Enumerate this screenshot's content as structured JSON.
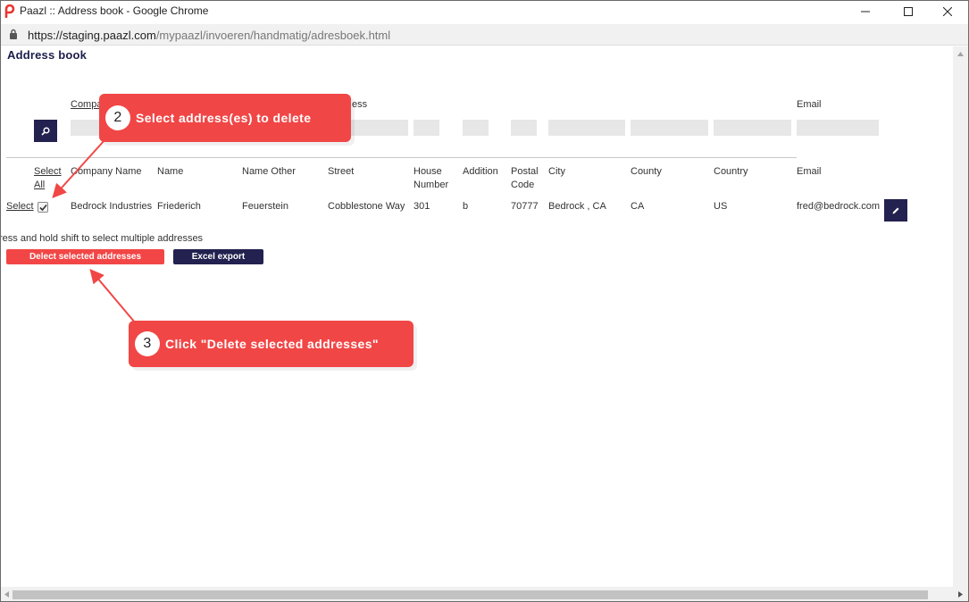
{
  "window": {
    "title": "Paazl :: Address book - Google Chrome",
    "icons": {
      "minimize": "minimize-icon",
      "maximize": "maximize-icon",
      "close": "close-icon",
      "app": "paazl-logo-icon"
    }
  },
  "addressbar": {
    "url_host": "https://staging.paazl.com",
    "url_path": "/mypaazl/invoeren/handmatig/adresboek.html",
    "icon": "lock-icon"
  },
  "page": {
    "title": "Address book"
  },
  "filter": {
    "headers": {
      "company": "Compa",
      "address": "ess",
      "email": "Email"
    },
    "search_icon": "search-icon"
  },
  "table": {
    "headers": {
      "select_all": "Select All",
      "company_name": "Company Name",
      "name": "Name",
      "name_other": "Name Other",
      "street": "Street",
      "house_number": "House Number",
      "addition": "Addition",
      "postal_code": "Postal Code",
      "city": "City",
      "county": "County",
      "country": "Country",
      "email": "Email"
    },
    "rows": [
      {
        "select": "Select",
        "checked": true,
        "company_name": "Bedrock Industries",
        "name": "Friederich",
        "name_other": "Feuerstein",
        "street": "Cobblestone Way",
        "house_number": "301",
        "addition": "b",
        "postal_code": "70777",
        "city": "Bedrock , CA",
        "county": "CA",
        "country": "US",
        "email": "fred@bedrock.com"
      }
    ],
    "edit_icon": "pencil-icon"
  },
  "hint": "ress and hold shift to select multiple addresses",
  "buttons": {
    "delete": "Delect selected addresses",
    "excel": "Excel export"
  },
  "annotations": [
    {
      "number": "2",
      "text": "Select address(es) to delete"
    },
    {
      "number": "3",
      "text": "Click \"Delete selected addresses\""
    }
  ],
  "colors": {
    "accent_red": "#f24646",
    "navy": "#22214f",
    "filter_gray": "#e7e7e7"
  }
}
